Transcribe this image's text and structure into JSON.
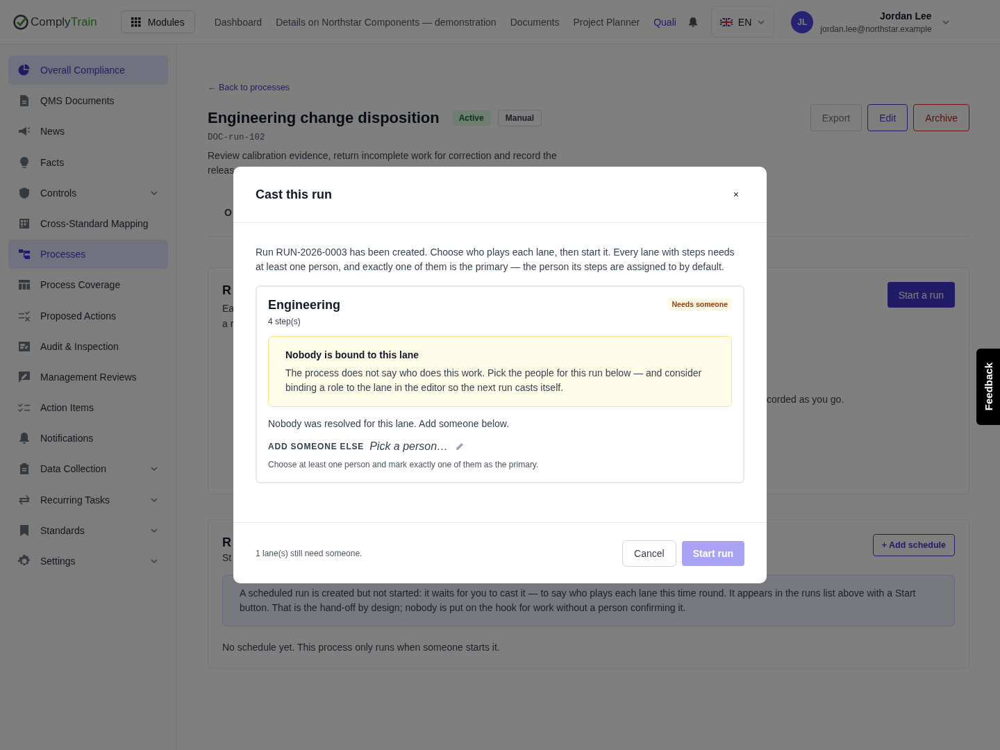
{
  "header": {
    "logo": {
      "prefix": "Comply",
      "suffix": "Train"
    },
    "modules_button": "Modules",
    "nav": [
      {
        "label": "Dashboard",
        "selected": false
      },
      {
        "label": "Details on Northstar Components — demonstration",
        "selected": false
      },
      {
        "label": "Documents",
        "selected": false
      },
      {
        "label": "Project Planner",
        "selected": false
      },
      {
        "label": "Quali",
        "selected": true
      }
    ],
    "language": "EN",
    "user": {
      "initials": "JL",
      "name": "Jordan Lee",
      "email": "jordan.lee@northstar.example"
    }
  },
  "sidebar": {
    "items": [
      {
        "label": "Overall Compliance",
        "selected": true,
        "expandable": false
      },
      {
        "label": "QMS Documents",
        "selected": false,
        "expandable": false
      },
      {
        "label": "News",
        "selected": false,
        "expandable": false
      },
      {
        "label": "Facts",
        "selected": false,
        "expandable": false
      },
      {
        "label": "Controls",
        "selected": false,
        "expandable": true
      },
      {
        "label": "Cross-Standard Mapping",
        "selected": false,
        "expandable": false
      },
      {
        "label": "Processes",
        "selected": true,
        "expandable": false
      },
      {
        "label": "Process Coverage",
        "selected": false,
        "expandable": false
      },
      {
        "label": "Proposed Actions",
        "selected": false,
        "expandable": false
      },
      {
        "label": "Audit & Inspection",
        "selected": false,
        "expandable": false
      },
      {
        "label": "Management Reviews",
        "selected": false,
        "expandable": false
      },
      {
        "label": "Action Items",
        "selected": false,
        "expandable": false
      },
      {
        "label": "Notifications",
        "selected": false,
        "expandable": false
      },
      {
        "label": "Data Collection",
        "selected": false,
        "expandable": true
      },
      {
        "label": "Recurring Tasks",
        "selected": false,
        "expandable": true
      },
      {
        "label": "Standards",
        "selected": false,
        "expandable": true
      },
      {
        "label": "Settings",
        "selected": false,
        "expandable": true
      }
    ]
  },
  "page": {
    "back_link": "← Back to processes",
    "title": "Engineering change disposition",
    "badges": [
      {
        "label": "Active",
        "kind": "status"
      },
      {
        "label": "Manual",
        "kind": "mode"
      }
    ],
    "code": "DOC-run-102",
    "description_lines": [
      "Review calibration evidence, return incomplete work for correction and record the",
      "releas"
    ],
    "actions": [
      {
        "label": "Export",
        "kind": "neutral"
      },
      {
        "label": "Edit",
        "kind": "primary"
      },
      {
        "label": "Archive",
        "kind": "danger"
      }
    ],
    "tab_fragment": "O",
    "runs_card": {
      "title": "R",
      "lines": [
        "Ea",
        "a r"
      ],
      "start_button": "Start a run",
      "tail": "corded as you go."
    },
    "schedule_card": {
      "title": "R",
      "subtitle": "St",
      "add_button": "+ Add schedule",
      "info": "A scheduled run is created but not started: it waits for you to cast it — to say who plays each lane this time round. It appears in the runs list above with a Start button. That is the hand-off by design; nobody is put on the hook for work without a person confirming it.",
      "empty": "No schedule yet. This process only runs when someone starts it."
    }
  },
  "feedback": "Feedback",
  "modal": {
    "title": "Cast this run",
    "close": "×",
    "intro": "Run RUN-2026-0003 has been created. Choose who plays each lane, then start it. Every lane with steps needs at least one person, and exactly one of them is the primary — the person its steps are assigned to by default.",
    "lane": {
      "name": "Engineering",
      "steps": "4 step(s)",
      "badge": "Needs someone",
      "warning": {
        "title": "Nobody is bound to this lane",
        "text": "The process does not say who does this work. Pick the people for this run below — and consider binding a role to the lane in the editor so the next run casts itself."
      },
      "resolved": "Nobody was resolved for this lane. Add someone below.",
      "add_label": "ADD SOMEONE ELSE",
      "placeholder": "Pick a person…",
      "hint": "Choose at least one person and mark exactly one of them as the primary."
    },
    "footer": {
      "status": "1 lane(s) still need someone.",
      "cancel": "Cancel",
      "start_button": {
        "label": "Start run",
        "disabled": true
      }
    }
  }
}
